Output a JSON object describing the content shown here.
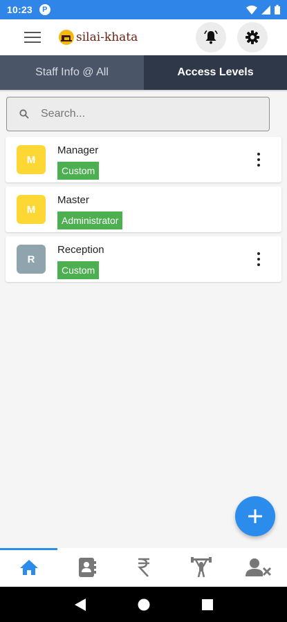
{
  "status_bar": {
    "time": "10:23",
    "notification_glyph": "P"
  },
  "app": {
    "title": "silai-khata"
  },
  "tabs": [
    {
      "label": "Staff Info @ All",
      "active": false
    },
    {
      "label": "Access Levels",
      "active": true
    }
  ],
  "search": {
    "placeholder": "Search..."
  },
  "access_levels": [
    {
      "initial": "M",
      "name": "Manager",
      "badge": "Custom",
      "avatar_color": "#fdd835",
      "has_menu": true
    },
    {
      "initial": "M",
      "name": "Master",
      "badge": "Administrator",
      "avatar_color": "#fdd835",
      "has_menu": false
    },
    {
      "initial": "R",
      "name": "Reception",
      "badge": "Custom",
      "avatar_color": "#90a4ae",
      "has_menu": true
    }
  ],
  "fab": {
    "icon": "plus-icon"
  },
  "bottom_nav": [
    {
      "icon": "home-icon",
      "active": true
    },
    {
      "icon": "contacts-book-icon",
      "active": false
    },
    {
      "icon": "rupee-icon",
      "active": false
    },
    {
      "icon": "weightlifter-icon",
      "active": false
    },
    {
      "icon": "user-remove-icon",
      "active": false
    }
  ],
  "colors": {
    "primary": "#2b8ceb",
    "status_bar": "#2f86e8",
    "tab_active": "#2e3848",
    "tab_inactive": "#4a5568",
    "badge": "#4caf50"
  }
}
